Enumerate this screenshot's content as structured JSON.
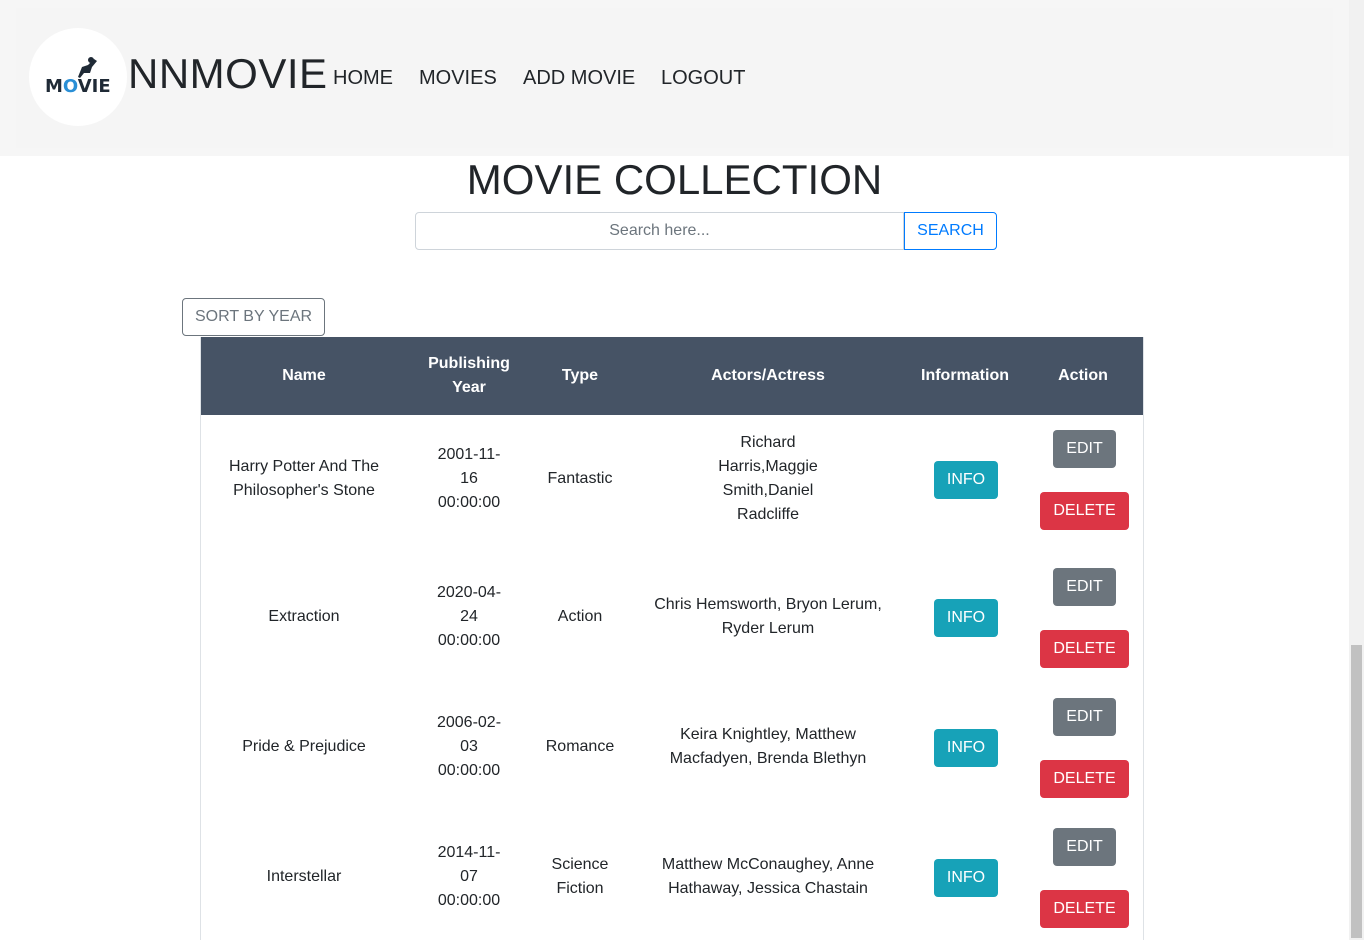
{
  "header": {
    "logo_text_prefix": "M",
    "logo_text_o": "O",
    "logo_text_suffix": "VIE",
    "brand": "NNMOVIE",
    "nav": [
      {
        "label": "HOME"
      },
      {
        "label": "MOVIES"
      },
      {
        "label": "ADD MOVIE"
      },
      {
        "label": "LOGOUT"
      }
    ]
  },
  "main": {
    "title": "MOVIE COLLECTION",
    "search": {
      "placeholder": "Search here...",
      "value": "",
      "button_label": "SEARCH"
    },
    "sort_label": "SORT BY YEAR"
  },
  "table": {
    "columns": [
      "Name",
      "Publishing Year",
      "Type",
      "Actors/Actress",
      "Information",
      "Action"
    ],
    "rows": [
      {
        "name": "Harry Potter And The Philosopher's Stone",
        "year": "2001-11-16 00:00:00",
        "type": "Fantastic",
        "actors": "Richard Harris,Maggie Smith,Daniel Radcliffe"
      },
      {
        "name": "Extraction",
        "year": "2020-04-24 00:00:00",
        "type": "Action",
        "actors": "Chris Hemsworth, Bryon Lerum, Ryder Lerum"
      },
      {
        "name": "Pride & Prejudice",
        "year": "2006-02-03 00:00:00",
        "type": "Romance",
        "actors": "Keira Knightley, Matthew Macfadyen, Brenda Blethyn"
      },
      {
        "name": "Interstellar",
        "year": "2014-11-07 00:00:00",
        "type": "Science Fiction",
        "actors": "Matthew McConaughey, Anne Hathaway, Jessica Chastain"
      }
    ],
    "info_label": "INFO",
    "edit_label": "EDIT",
    "delete_label": "DELETE"
  },
  "colors": {
    "header_bg": "#f5f5f5",
    "table_head": "#465365",
    "info": "#17a2b8",
    "edit": "#6c757d",
    "delete": "#dc3545",
    "primary": "#007bff"
  }
}
